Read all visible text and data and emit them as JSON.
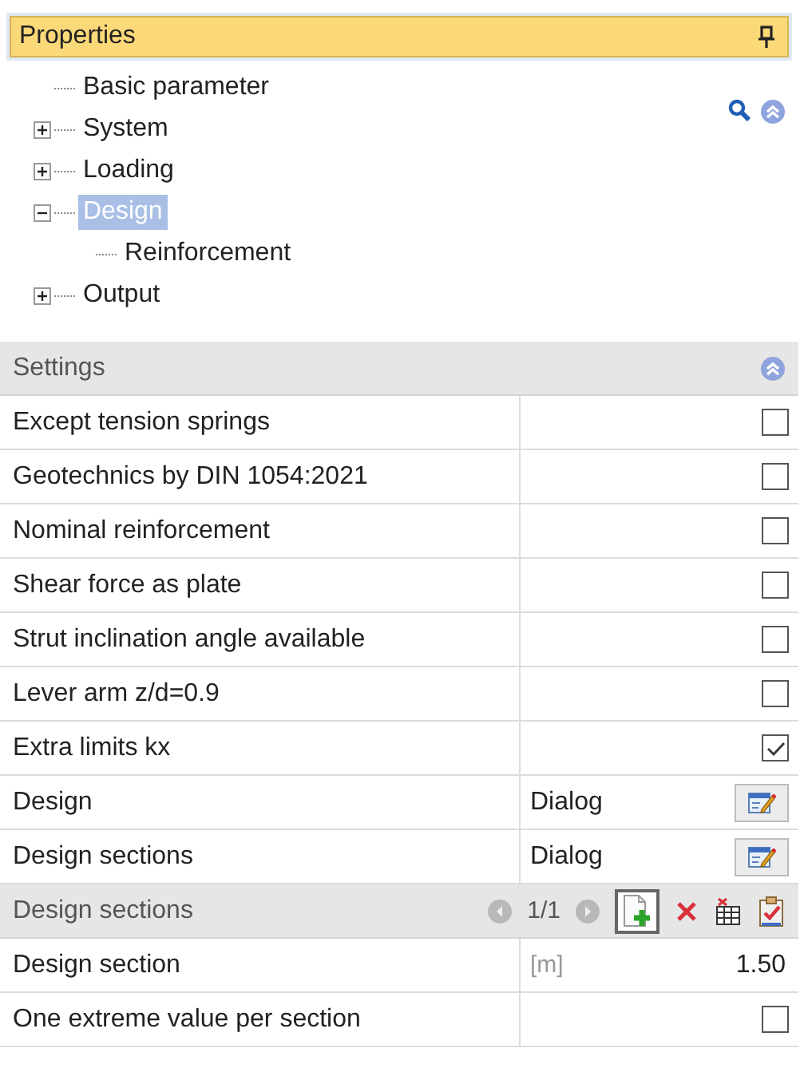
{
  "panel": {
    "title": "Properties"
  },
  "tree": [
    {
      "label": "Basic parameter",
      "selected": false
    },
    {
      "label": "System",
      "expanded": false,
      "selected": false
    },
    {
      "label": "Loading",
      "expanded": false,
      "selected": false
    },
    {
      "label": "Design",
      "expanded": true,
      "selected": true,
      "children": [
        {
          "label": "Reinforcement",
          "selected": false
        }
      ]
    },
    {
      "label": "Output",
      "expanded": false,
      "selected": false
    }
  ],
  "settings": {
    "title": "Settings",
    "rows": [
      {
        "kind": "checkbox",
        "label": "Except tension springs",
        "checked": false
      },
      {
        "kind": "checkbox",
        "label": "Geotechnics by DIN 1054:2021",
        "checked": false
      },
      {
        "kind": "checkbox",
        "label": "Nominal reinforcement",
        "checked": false
      },
      {
        "kind": "checkbox",
        "label": "Shear force as plate",
        "checked": false
      },
      {
        "kind": "checkbox",
        "label": "Strut inclination angle available",
        "checked": false
      },
      {
        "kind": "checkbox",
        "label": "Lever arm z/d=0.9",
        "checked": false
      },
      {
        "kind": "checkbox",
        "label": "Extra limits kx",
        "checked": true
      },
      {
        "kind": "dialog",
        "label": "Design",
        "value": "Dialog"
      },
      {
        "kind": "dialog",
        "label": "Design sections",
        "value": "Dialog"
      }
    ]
  },
  "sections": {
    "title": "Design sections",
    "pager": "1/1",
    "rows": [
      {
        "kind": "value",
        "label": "Design section",
        "unit": "[m]",
        "value": "1.50"
      },
      {
        "kind": "checkbox",
        "label": "One extreme value per section",
        "checked": false
      }
    ]
  }
}
